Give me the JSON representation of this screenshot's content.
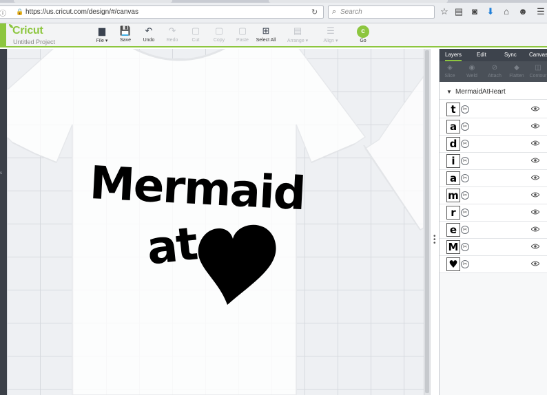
{
  "browser": {
    "url": "https://us.cricut.com/design/#/canvas",
    "search_placeholder": "Search",
    "icons": [
      "info-icon",
      "lock-icon",
      "reload-icon",
      "search-icon",
      "bookmark-star-icon",
      "reading-list-icon",
      "pocket-icon",
      "download-icon",
      "home-icon",
      "chat-icon",
      "menu-icon"
    ]
  },
  "app": {
    "logo": "Cricut",
    "project_name": "Untitled Project",
    "accent_color": "#8dc63f",
    "toolbar": [
      {
        "id": "file",
        "label": "File ▾",
        "icon": "folder-icon",
        "glyph": "▆",
        "enabled": true
      },
      {
        "id": "save",
        "label": "Save",
        "icon": "save-icon",
        "glyph": "💾",
        "enabled": true
      },
      {
        "id": "undo",
        "label": "Undo",
        "icon": "undo-icon",
        "glyph": "↶",
        "enabled": true
      },
      {
        "id": "redo",
        "label": "Redo",
        "icon": "redo-icon",
        "glyph": "↷",
        "enabled": false
      },
      {
        "id": "cut",
        "label": "Cut",
        "icon": "cut-icon",
        "glyph": "▢",
        "enabled": false
      },
      {
        "id": "copy",
        "label": "Copy",
        "icon": "copy-icon",
        "glyph": "▢",
        "enabled": false
      },
      {
        "id": "paste",
        "label": "Paste",
        "icon": "paste-icon",
        "glyph": "▢",
        "enabled": false
      },
      {
        "id": "select_all",
        "label": "Select All",
        "icon": "select-all-icon",
        "glyph": "⊞",
        "enabled": true
      },
      {
        "id": "arrange",
        "label": "Arrange ▾",
        "icon": "arrange-icon",
        "glyph": "▤",
        "enabled": false
      },
      {
        "id": "align",
        "label": "Align ▾",
        "icon": "align-icon",
        "glyph": "☰",
        "enabled": false
      }
    ],
    "go": {
      "glyph": "c",
      "label": "Go"
    }
  },
  "canvas": {
    "design_text_line1": "Mermaid",
    "design_text_line2": "at",
    "design_icon": "heart-icon"
  },
  "panel": {
    "tabs": [
      {
        "label": "Layers",
        "active": true
      },
      {
        "label": "Edit",
        "active": false
      },
      {
        "label": "Sync",
        "active": false
      },
      {
        "label": "Canvas",
        "active": false
      }
    ],
    "tools": [
      {
        "label": "Slice",
        "icon": "slice-icon",
        "glyph": "◈"
      },
      {
        "label": "Weld",
        "icon": "weld-icon",
        "glyph": "◉"
      },
      {
        "label": "Attach",
        "icon": "attach-icon",
        "glyph": "⊘"
      },
      {
        "label": "Flatten",
        "icon": "flatten-icon",
        "glyph": "◆"
      },
      {
        "label": "Contour",
        "icon": "contour-icon",
        "glyph": "◫"
      }
    ],
    "group_name": "MermaidAtHeart",
    "layers": [
      {
        "glyph": "t",
        "name": "t"
      },
      {
        "glyph": "a",
        "name": "a"
      },
      {
        "glyph": "d",
        "name": "d"
      },
      {
        "glyph": "i",
        "name": "i"
      },
      {
        "glyph": "a",
        "name": "a"
      },
      {
        "glyph": "m",
        "name": "m"
      },
      {
        "glyph": "r",
        "name": "r"
      },
      {
        "glyph": "e",
        "name": "e"
      },
      {
        "glyph": "M",
        "name": "M"
      },
      {
        "glyph": "♥",
        "name": "heart"
      }
    ]
  }
}
